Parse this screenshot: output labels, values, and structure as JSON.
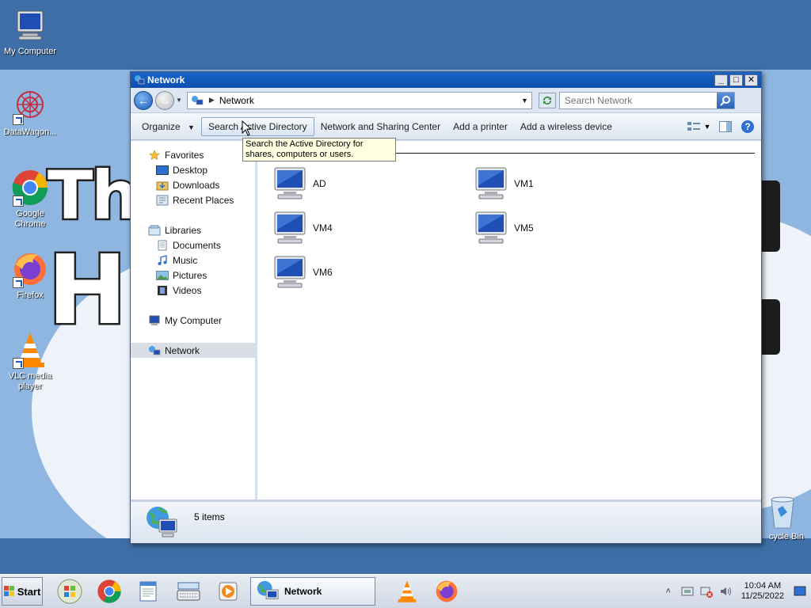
{
  "desktop": {
    "icons": [
      {
        "label": "My Computer",
        "icon": "computer-icon"
      },
      {
        "label": "DataWagon...",
        "icon": "datawagon-icon"
      },
      {
        "label": "Google Chrome",
        "icon": "chrome-icon"
      },
      {
        "label": "Firefox",
        "icon": "firefox-icon"
      },
      {
        "label": "VLC media player",
        "icon": "vlc-icon"
      },
      {
        "label": "cycle Bin",
        "icon": "recycle-bin-icon"
      }
    ],
    "wallpaper_text": [
      "The",
      "H"
    ]
  },
  "window": {
    "title": "Network",
    "controls": {
      "minimize": "_",
      "maximize": "□",
      "close": "✕"
    }
  },
  "addressbar": {
    "breadcrumb": "Network",
    "search_placeholder": "Search Network"
  },
  "toolbar": {
    "organize": "Organize",
    "search_ad": "Search Active Directory",
    "network_sharing": "Network and Sharing Center",
    "add_printer": "Add a printer",
    "add_wireless": "Add a wireless device"
  },
  "tooltip": {
    "text": "Search the Active Directory for shares, computers or users."
  },
  "nav": {
    "favorites": "Favorites",
    "desktop": "Desktop",
    "downloads": "Downloads",
    "recent": "Recent Places",
    "libraries": "Libraries",
    "documents": "Documents",
    "music": "Music",
    "pictures": "Pictures",
    "videos": "Videos",
    "my_computer": "My Computer",
    "network": "Network"
  },
  "items": [
    "AD",
    "VM1",
    "VM4",
    "VM5",
    "VM6"
  ],
  "status": {
    "count": "5 items"
  },
  "taskbar": {
    "start": "Start",
    "active_task": "Network",
    "time": "10:04 AM",
    "date": "11/25/2022"
  }
}
